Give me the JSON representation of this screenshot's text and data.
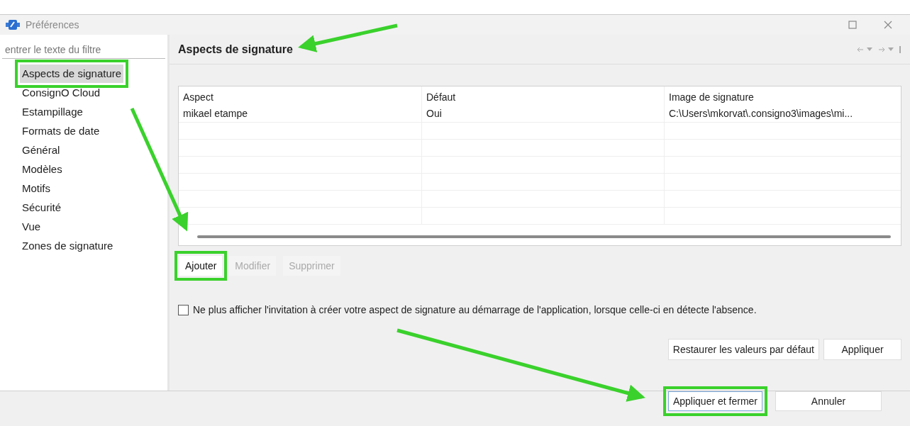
{
  "window": {
    "title": "Préférences"
  },
  "filter": {
    "placeholder": "entrer le texte du filtre"
  },
  "sidebar": {
    "items": [
      {
        "label": "Aspects de signature",
        "selected": true,
        "highlighted": true
      },
      {
        "label": "ConsignO Cloud",
        "selected": false,
        "highlighted": false
      },
      {
        "label": "Estampillage",
        "selected": false,
        "highlighted": false
      },
      {
        "label": "Formats de date",
        "selected": false,
        "highlighted": false
      },
      {
        "label": "Général",
        "selected": false,
        "highlighted": false
      },
      {
        "label": "Modèles",
        "selected": false,
        "highlighted": false
      },
      {
        "label": "Motifs",
        "selected": false,
        "highlighted": false
      },
      {
        "label": "Sécurité",
        "selected": false,
        "highlighted": false
      },
      {
        "label": "Vue",
        "selected": false,
        "highlighted": false
      },
      {
        "label": "Zones de signature",
        "selected": false,
        "highlighted": false
      }
    ]
  },
  "page": {
    "title": "Aspects de signature",
    "table": {
      "columns": [
        "Aspect",
        "Défaut",
        "Image de signature"
      ],
      "rows": [
        [
          "mikael etampe",
          "Oui",
          "C:\\Users\\mkorvat\\.consigno3\\images\\mi..."
        ]
      ]
    },
    "actions": [
      {
        "label": "Ajouter",
        "disabled": false,
        "highlighted": true
      },
      {
        "label": "Modifier",
        "disabled": true,
        "highlighted": false
      },
      {
        "label": "Supprimer",
        "disabled": true,
        "highlighted": false
      }
    ],
    "option": {
      "label": "Ne plus afficher l'invitation à créer votre aspect de signature au démarrage de l'application, lorsque celle-ci en détecte l'absence.",
      "checked": false
    },
    "page_buttons": [
      {
        "label": "Restaurer les valeurs par défaut",
        "highlighted": false
      },
      {
        "label": "Appliquer",
        "highlighted": false
      }
    ]
  },
  "dialog_buttons": [
    {
      "label": "Appliquer et fermer",
      "highlighted": true
    },
    {
      "label": "Annuler",
      "highlighted": false
    }
  ]
}
